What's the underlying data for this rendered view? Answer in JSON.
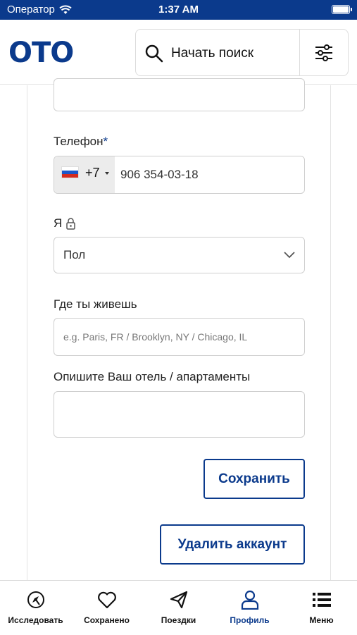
{
  "status_bar": {
    "carrier": "Оператор",
    "time": "1:37 AM"
  },
  "header": {
    "logo": "OTO",
    "search_label": "Начать поиск"
  },
  "form": {
    "phone_label": "Телефон",
    "phone_required_mark": "*",
    "country_code": "+7",
    "phone_value": "906 354-03-18",
    "gender_label": "Я",
    "gender_value": "Пол",
    "location_label": "Где ты живешь",
    "location_placeholder": "e.g. Paris, FR / Brooklyn, NY / Chicago, IL",
    "description_label": "Опишите Ваш отель / апартаменты",
    "description_value": "",
    "save_label": "Сохранить",
    "delete_label": "Удалить аккаунт"
  },
  "tabbar": {
    "items": [
      {
        "label": "Исследовать",
        "icon": "explore-icon"
      },
      {
        "label": "Сохранено",
        "icon": "heart-icon"
      },
      {
        "label": "Поездки",
        "icon": "paper-plane-icon"
      },
      {
        "label": "Профиль",
        "icon": "profile-icon",
        "active": true
      },
      {
        "label": "Меню",
        "icon": "menu-icon"
      }
    ]
  },
  "colors": {
    "brand": "#0b3a8c",
    "border": "#cfcfcf"
  }
}
